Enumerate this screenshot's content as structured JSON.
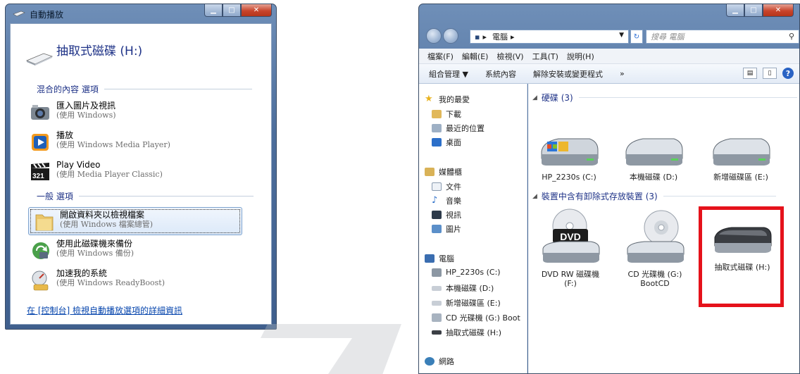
{
  "autoplay": {
    "title": "自動播放",
    "device_name": "抽取式磁碟 (H:)",
    "sections": {
      "mixed": "混合的內容 選項",
      "general": "一般 選項"
    },
    "items": [
      {
        "label": "匯入圖片及視訊",
        "sub": "(使用 Windows)"
      },
      {
        "label": "播放",
        "sub": "(使用 Windows Media Player)"
      },
      {
        "label": "Play Video",
        "sub": "(使用 Media Player Classic)"
      },
      {
        "label": "開啟資料夾以檢視檔案",
        "sub": "(使用 Windows 檔案總管)"
      },
      {
        "label": "使用此磁碟機來備份",
        "sub": "(使用 Windows 備份)"
      },
      {
        "label": "加速我的系統",
        "sub": "(使用 Windows ReadyBoost)"
      }
    ],
    "link": "在 [控制台] 檢視自動播放選項的詳細資訊"
  },
  "explorer": {
    "address": "電腦",
    "search_placeholder": "搜尋 電腦",
    "menu": [
      "檔案(F)",
      "編輯(E)",
      "檢視(V)",
      "工具(T)",
      "說明(H)"
    ],
    "commands": [
      "組合管理 ▼",
      "系統內容",
      "解除安裝或變更程式",
      "»"
    ],
    "nav": {
      "favorites": "我的最愛",
      "downloads": "下載",
      "recent": "最近的位置",
      "desktop": "桌面",
      "libraries": "媒體櫃",
      "documents": "文件",
      "music": "音樂",
      "videos": "視訊",
      "pictures": "圖片",
      "computer": "電腦",
      "drive_c": "HP_2230s (C:)",
      "drive_d": "本機磁碟 (D:)",
      "drive_e": "新增磁碟區 (E:)",
      "drive_g": "CD 光碟機 (G:) Boot",
      "drive_h": "抽取式磁碟 (H:)",
      "network": "網路"
    },
    "groups": {
      "hdd": "硬碟 (3)",
      "removable": "裝置中含有卸除式存放裝置 (3)"
    },
    "drives": [
      {
        "label": "HP_2230s (C:)"
      },
      {
        "label": "本機磁碟 (D:)"
      },
      {
        "label": "新增磁碟區 (E:)"
      },
      {
        "label": "DVD RW 磁碟機",
        "label2": "(F:)"
      },
      {
        "label": "CD 光碟機 (G:)",
        "label2": "BootCD"
      },
      {
        "label": "抽取式磁碟 (H:)"
      }
    ]
  }
}
